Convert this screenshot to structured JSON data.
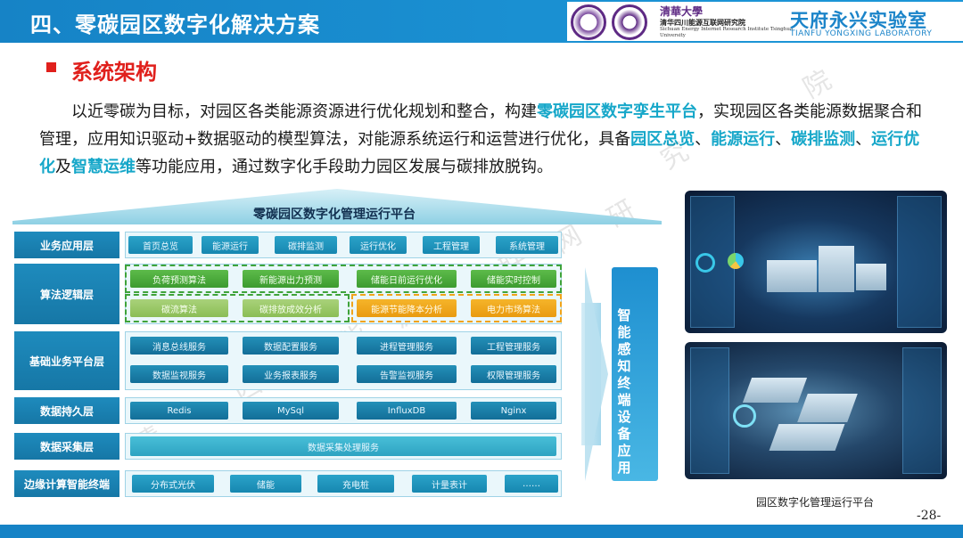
{
  "header": {
    "title": "四、零碳园区数字化解决方案",
    "institute_cn_top": "清華大學",
    "institute_cn": "清华四川能源互联网研究院",
    "institute_en": "Sichuan Energy Internet Research Institute Tsinghua University",
    "lab_cn": "天府永兴实验室",
    "lab_en": "TIANFU YONGXING LABORATORY"
  },
  "section_title": "系统架构",
  "paragraph": {
    "t1": "以近零碳为目标，对园区各类能源资源进行优化规划和整合，构建",
    "h1": "零碳园区数字孪生平台",
    "t2": "，实现园区各类能源数据聚合和管理，应用知识驱动+数据驱动的模型算法，对能源系统运行和运营进行优化，具备",
    "h2": "园区总览",
    "t3": "、",
    "h3": "能源运行",
    "t4": "、",
    "h4": "碳排监测",
    "t5": "、",
    "h5": "运行优化",
    "t6": "及",
    "h6": "智慧运维",
    "t7": "等功能应用，通过数字化手段助力园区发展与碳排放脱钩。"
  },
  "watermark": [
    "清",
    "华",
    "四",
    "川",
    "能",
    "源",
    "互",
    "联",
    "网",
    "研",
    "究",
    "院"
  ],
  "diagram": {
    "title": "零碳园区数字化管理运行平台",
    "side_arrow_text": "智能感知终端设备应用",
    "layers": {
      "app": {
        "label": "业务应用层",
        "items": [
          "首页总览",
          "能源运行",
          "碳排监测",
          "运行优化",
          "工程管理",
          "系统管理"
        ]
      },
      "algo": {
        "label": "算法逻辑层",
        "row1": [
          "负荷预测算法",
          "新能源出力预测",
          "储能日前运行优化",
          "储能实时控制"
        ],
        "row2": [
          "碳流算法",
          "碳排放成效分析",
          "能源节能降本分析",
          "电力市场算法"
        ]
      },
      "platform": {
        "label": "基础业务平台层",
        "row1": [
          "消息总线服务",
          "数据配置服务",
          "进程管理服务",
          "工程管理服务"
        ],
        "row2": [
          "数据监视服务",
          "业务报表服务",
          "告警监视服务",
          "权限管理服务"
        ]
      },
      "persist": {
        "label": "数据持久层",
        "items": [
          "Redis",
          "MySql",
          "InfluxDB",
          "Nginx"
        ]
      },
      "collect": {
        "label": "数据采集层",
        "items": [
          "数据采集处理服务"
        ]
      },
      "edge": {
        "label": "边缘计算智能终端",
        "items": [
          "分布式光伏",
          "储能",
          "充电桩",
          "计量表计",
          "……"
        ]
      }
    }
  },
  "screenshot_caption": "园区数字化管理运行平台",
  "page_number": "-28-",
  "colors": {
    "brand_blue": "#1683c6",
    "accent_red": "#e0201c",
    "highlight_teal": "#16a7c9"
  },
  "icons": [
    "university-seal-icon",
    "institute-seal-icon"
  ]
}
